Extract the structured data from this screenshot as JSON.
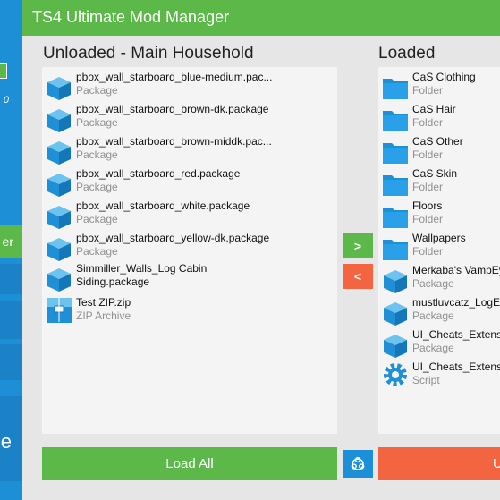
{
  "app": {
    "title": "TS4 Ultimate Mod Manager"
  },
  "sidebar": {
    "version_text": "0",
    "strip_text": "er",
    "big_text": "e"
  },
  "unloaded": {
    "title": "Unloaded - Main Household",
    "items": [
      {
        "name": "pbox_wall_starboard_blue-medium.pac...",
        "type": "Package",
        "icon": "package-icon"
      },
      {
        "name": "pbox_wall_starboard_brown-dk.package",
        "type": "Package",
        "icon": "package-icon"
      },
      {
        "name": "pbox_wall_starboard_brown-middk.pac...",
        "type": "Package",
        "icon": "package-icon"
      },
      {
        "name": "pbox_wall_starboard_red.package",
        "type": "Package",
        "icon": "package-icon"
      },
      {
        "name": "pbox_wall_starboard_white.package",
        "type": "Package",
        "icon": "package-icon"
      },
      {
        "name": "pbox_wall_starboard_yellow-dk.package",
        "type": "Package",
        "icon": "package-icon"
      },
      {
        "name": "Simmiller_Walls_Log Cabin",
        "name2": "Siding.package",
        "icon": "package-icon"
      },
      {
        "name": "Test ZIP.zip",
        "type": "ZIP Archive",
        "icon": "zip-archive-icon"
      }
    ]
  },
  "loaded": {
    "title": "Loaded",
    "items": [
      {
        "name": "CaS Clothing",
        "type": "Folder",
        "icon": "folder-icon"
      },
      {
        "name": "CaS Hair",
        "type": "Folder",
        "icon": "folder-icon"
      },
      {
        "name": "CaS Other",
        "type": "Folder",
        "icon": "folder-icon"
      },
      {
        "name": "CaS Skin",
        "type": "Folder",
        "icon": "folder-icon"
      },
      {
        "name": "Floors",
        "type": "Folder",
        "icon": "folder-icon"
      },
      {
        "name": "Wallpapers",
        "type": "Folder",
        "icon": "folder-icon"
      },
      {
        "name": "Merkaba's VampEy",
        "type": "Package",
        "icon": "package-icon"
      },
      {
        "name": "mustluvcatz_LogEx",
        "type": "Package",
        "icon": "package-icon"
      },
      {
        "name": "UI_Cheats_Extensio",
        "type": "Package",
        "icon": "package-icon"
      },
      {
        "name": "UI_Cheats_Extensio",
        "type": "Script",
        "icon": "script-gear-icon"
      }
    ]
  },
  "buttons": {
    "move_right": ">",
    "move_left": "<",
    "load_all": "Load All",
    "unload_all": "U"
  },
  "colors": {
    "green": "#5bb849",
    "blue": "#1c8fd6",
    "red": "#f36541"
  }
}
